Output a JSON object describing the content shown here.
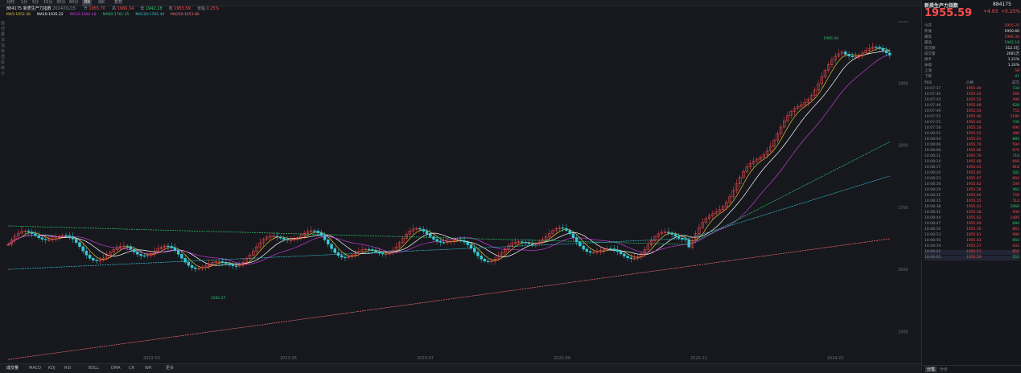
{
  "toolbar": {
    "periods": [
      "分时",
      "1分",
      "5分",
      "15分",
      "30分",
      "60分",
      "日K",
      "周K"
    ],
    "active_period": "日K",
    "extra": [
      "复权"
    ]
  },
  "info": {
    "code": "884175",
    "name": "新质生产力指数",
    "date": "2024/01/15",
    "items": [
      {
        "label": "开",
        "value": "1955.70",
        "color": "#ff4d4f"
      },
      {
        "label": "高",
        "value": "1966.34",
        "color": "#ff4d4f"
      },
      {
        "label": "低",
        "value": "1942.18",
        "color": "#2ecc71"
      },
      {
        "label": "收",
        "value": "1955.59",
        "color": "#ff4d4f"
      },
      {
        "label": "涨幅",
        "value": "0.25%",
        "color": "#ff4d4f"
      }
    ]
  },
  "ma": {
    "items": [
      {
        "label": "MA5",
        "value": "1952.36",
        "color": "#e6c22e"
      },
      {
        "label": "MA10",
        "value": "1935.22",
        "color": "#ffffff"
      },
      {
        "label": "MA20",
        "value": "1880.48",
        "color": "#c33ad6"
      },
      {
        "label": "MA60",
        "value": "1761.35",
        "color": "#2ecc71"
      },
      {
        "label": "MA120",
        "value": "1702.44",
        "color": "#37c8d4"
      },
      {
        "label": "MA250",
        "value": "1651.80",
        "color": "#ff6f7a"
      }
    ]
  },
  "left_tools": [
    "画",
    "线",
    "叠",
    "加",
    "指",
    "标",
    "选",
    "股",
    "统",
    "计"
  ],
  "chart_data": {
    "type": "candlestick",
    "ylim": [
      1450,
      2000
    ],
    "y_ticks": [
      "2000",
      "1900",
      "1800",
      "1700",
      "1600",
      "1500"
    ],
    "x_ticks": [
      "2023-03",
      "2023-05",
      "2023-07",
      "2023-09",
      "2023-11",
      "2024-01"
    ],
    "annotations": [
      {
        "text": "1562.27",
        "x_index": 60
      },
      {
        "text": "1966.34",
        "x_index": 240
      }
    ],
    "candles_note": "flat range then sharp rally",
    "series": [
      {
        "name": "MA5",
        "color": "#e6c22e"
      },
      {
        "name": "MA10",
        "color": "#ffffff"
      },
      {
        "name": "MA20",
        "color": "#c33ad6"
      },
      {
        "name": "MA60",
        "color": "#2ecc71"
      },
      {
        "name": "MA120",
        "color": "#37c8d4"
      },
      {
        "name": "MA250",
        "color": "#ff6f7a"
      }
    ]
  },
  "bottom_tabs": [
    "成交量",
    "MACD",
    "KDJ",
    "RSI",
    "BOLL",
    "DMA",
    "CR",
    "WR",
    "更多"
  ],
  "right": {
    "name": "新质生产力指数",
    "code": "884175",
    "price": "1955.59",
    "change": "+4.93",
    "change_pct": "+0.25%",
    "tabs": [
      "分时",
      "日K"
    ],
    "stats": [
      {
        "l": "今开",
        "v": "1955.70",
        "c": "red"
      },
      {
        "l": "昨收",
        "v": "1950.66",
        "c": "white"
      },
      {
        "l": "最高",
        "v": "1966.34",
        "c": "red"
      },
      {
        "l": "最低",
        "v": "1942.18",
        "c": "green"
      },
      {
        "l": "成交额",
        "v": "312.5亿",
        "c": "white"
      },
      {
        "l": "成交量",
        "v": "2681万",
        "c": "white"
      },
      {
        "l": "换手",
        "v": "1.21%",
        "c": "white"
      },
      {
        "l": "振幅",
        "v": "1.24%",
        "c": "white"
      },
      {
        "l": "上涨",
        "v": "58",
        "c": "red"
      },
      {
        "l": "下跌",
        "v": "41",
        "c": "green"
      }
    ],
    "ticks_header": [
      "时间",
      "价格",
      "成交"
    ],
    "ticks": [
      {
        "t": "10:07:37",
        "p": "1955.40",
        "v": "734"
      },
      {
        "t": "10:07:40",
        "p": "1955.45",
        "v": "568"
      },
      {
        "t": "10:07:43",
        "p": "1955.52",
        "v": "490"
      },
      {
        "t": "10:07:46",
        "p": "1955.48",
        "v": "628"
      },
      {
        "t": "10:07:49",
        "p": "1955.54",
        "v": "752"
      },
      {
        "t": "10:07:52",
        "p": "1955.60",
        "v": "1180"
      },
      {
        "t": "10:07:55",
        "p": "1955.62",
        "v": "706"
      },
      {
        "t": "10:07:58",
        "p": "1955.58",
        "v": "690"
      },
      {
        "t": "10:08:02",
        "p": "1955.55",
        "v": "486"
      },
      {
        "t": "10:08:04",
        "p": "1955.61",
        "v": "880"
      },
      {
        "t": "10:08:06",
        "p": "1955.70",
        "v": "594"
      },
      {
        "t": "10:08:08",
        "p": "1955.66",
        "v": "676"
      },
      {
        "t": "10:08:11",
        "p": "1955.70",
        "v": "710"
      },
      {
        "t": "10:08:14",
        "p": "1955.68",
        "v": "666"
      },
      {
        "t": "10:08:17",
        "p": "1955.63",
        "v": "818"
      },
      {
        "t": "10:08:20",
        "p": "1955.65",
        "v": "582"
      },
      {
        "t": "10:08:23",
        "p": "1955.67",
        "v": "604"
      },
      {
        "t": "10:08:26",
        "p": "1955.62",
        "v": "549"
      },
      {
        "t": "10:08:29",
        "p": "1955.58",
        "v": "460"
      },
      {
        "t": "10:08:32",
        "p": "1955.60",
        "v": "728"
      },
      {
        "t": "10:08:35",
        "p": "1955.55",
        "v": "512"
      },
      {
        "t": "10:08:38",
        "p": "1955.61",
        "v": "1060"
      },
      {
        "t": "10:08:41",
        "p": "1955.58",
        "v": "946"
      },
      {
        "t": "10:08:44",
        "p": "1955.62",
        "v": "1480"
      },
      {
        "t": "10:08:47",
        "p": "1955.60",
        "v": "684"
      },
      {
        "t": "10:08:50",
        "p": "1955.56",
        "v": "861"
      },
      {
        "t": "10:08:53",
        "p": "1955.61",
        "v": "990"
      },
      {
        "t": "10:08:56",
        "p": "1955.63",
        "v": "660"
      },
      {
        "t": "10:08:59",
        "p": "1955.57",
        "v": "642"
      },
      {
        "t": "10:09:02",
        "p": "1955.57",
        "v": "850"
      },
      {
        "t": "10:09:05",
        "p": "1955.59",
        "v": "553"
      }
    ],
    "footer_tabs": [
      "分笔",
      "分价"
    ]
  }
}
